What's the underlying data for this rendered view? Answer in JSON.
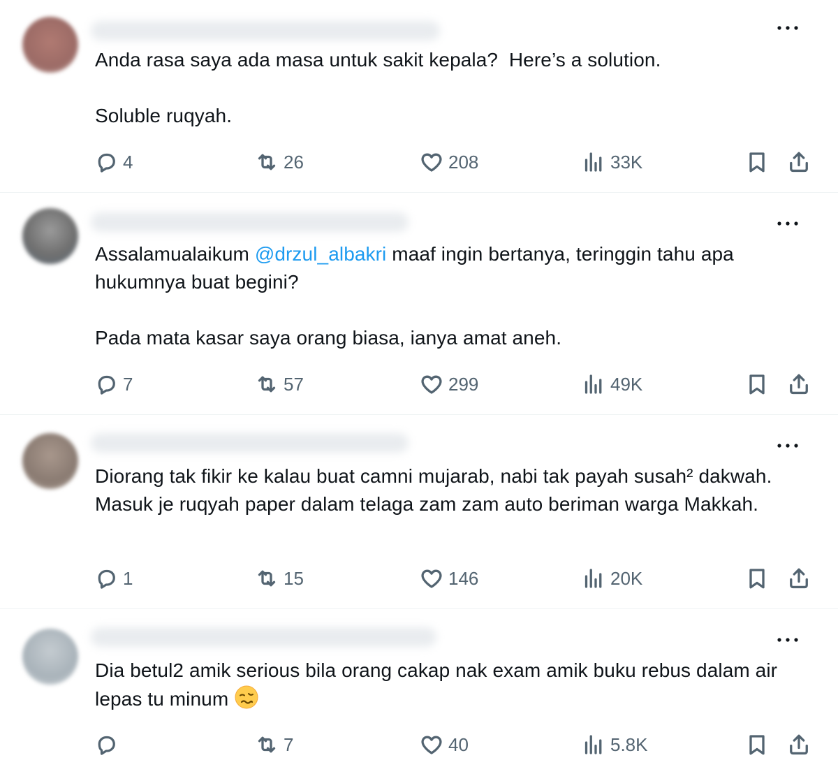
{
  "colors": {
    "accent": "#1d9bf0",
    "text": "#0f1419",
    "secondary": "#536471",
    "divider": "#eff3f4"
  },
  "icons": {
    "reply": "reply-icon",
    "repost": "repost-icon",
    "like": "like-icon",
    "views": "views-icon",
    "bookmark": "bookmark-icon",
    "share": "share-icon",
    "more": "more-options-icon"
  },
  "tweets": [
    {
      "text_lines": "Anda rasa saya ada masa untuk sakit kepala?  Here’s a solution.\n\nSoluble ruqyah.",
      "replies": "4",
      "reposts": "26",
      "likes": "208",
      "views": "33K"
    },
    {
      "text_before": "Assalamualaikum ",
      "mention": "@drzul_albakri",
      "text_after": " maaf ingin bertanya, teringgin tahu apa hukumnya buat begini?\n\nPada mata kasar saya orang biasa, ianya amat aneh.",
      "replies": "7",
      "reposts": "57",
      "likes": "299",
      "views": "49K"
    },
    {
      "text_lines": "Diorang tak fikir ke kalau buat camni mujarab, nabi tak payah susah² dakwah. Masuk je ruqyah paper dalam telaga zam zam auto beriman warga Makkah.",
      "replies": "1",
      "reposts": "15",
      "likes": "146",
      "views": "20K"
    },
    {
      "text_lines": "Dia betul2 amik serious bila orang cakap nak exam amik buku rebus dalam air lepas tu minum ",
      "emoji": "woozy-face-emoji",
      "replies": "",
      "reposts": "7",
      "likes": "40",
      "views": "5.8K"
    }
  ]
}
